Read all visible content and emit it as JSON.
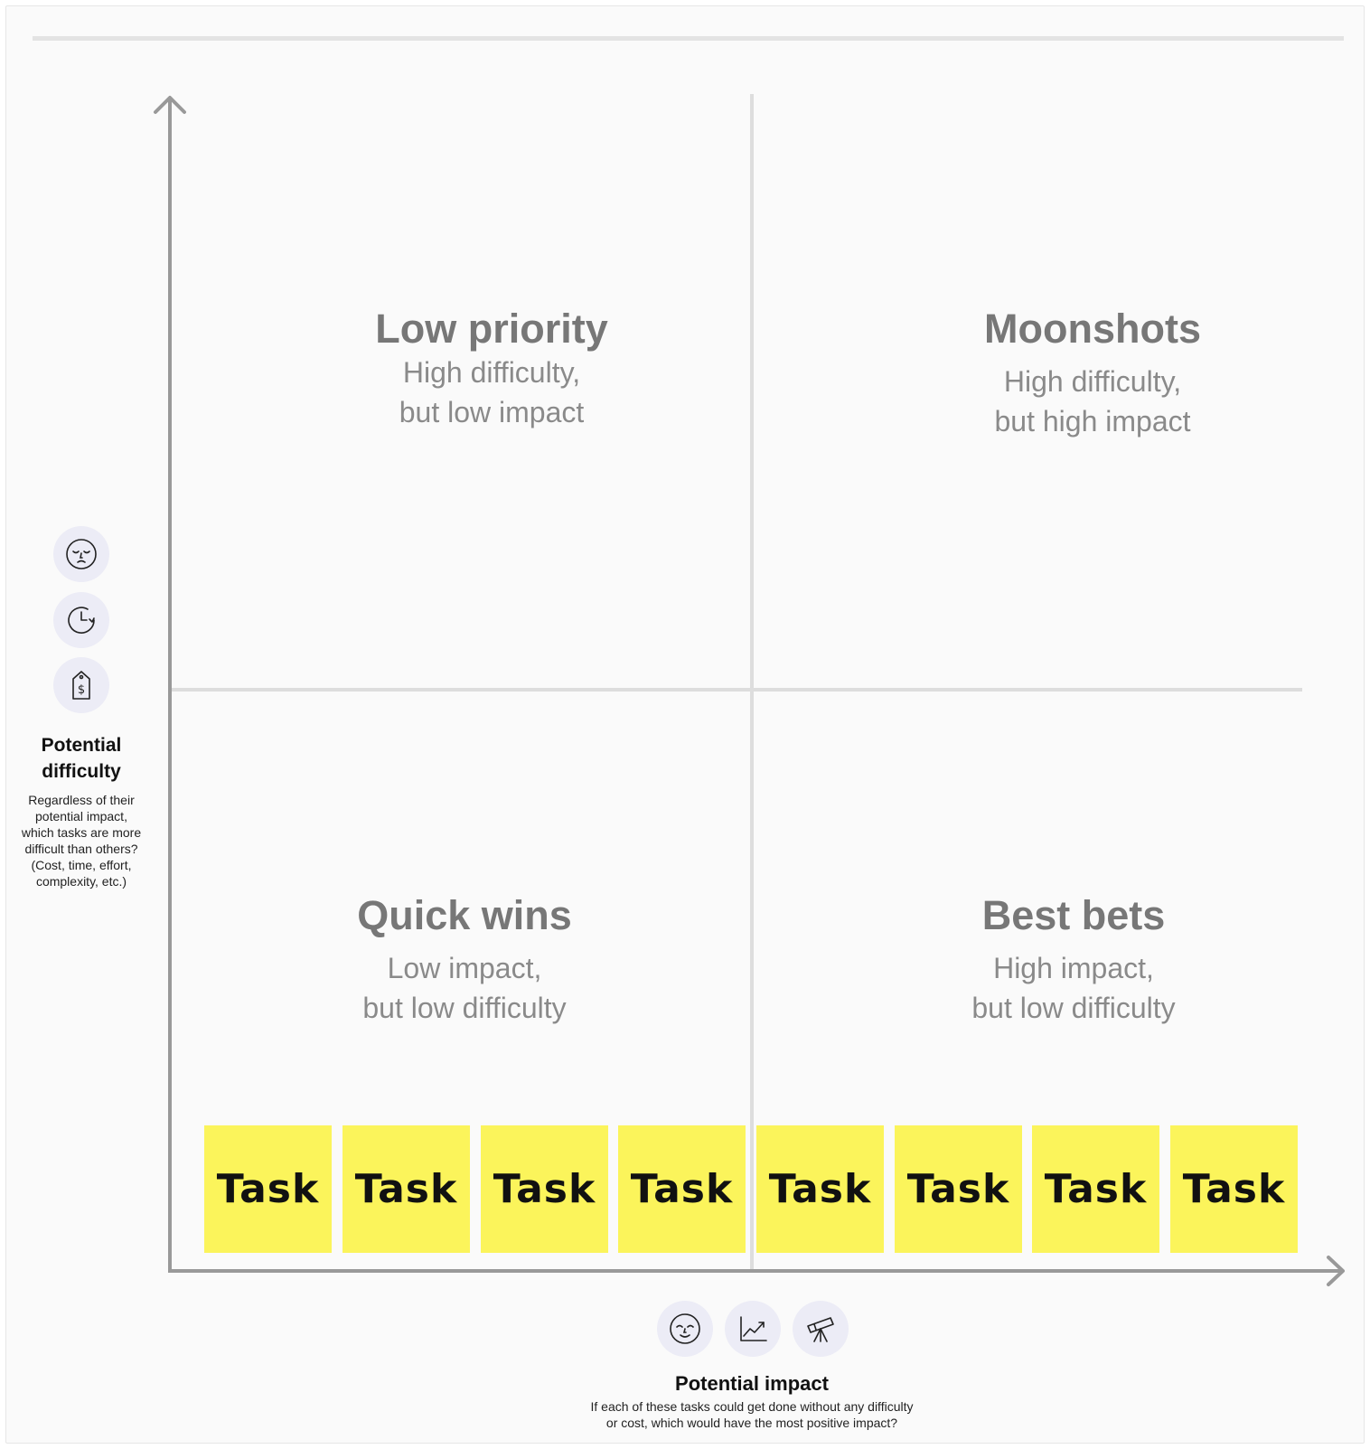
{
  "quadrants": {
    "top_left": {
      "title": "Low priority",
      "line1": "High difficulty,",
      "line2": "but low impact"
    },
    "top_right": {
      "title": "Moonshots",
      "line1": "High difficulty,",
      "line2": "but high impact"
    },
    "bottom_left": {
      "title": "Quick wins",
      "line1": "Low impact,",
      "line2": "but low difficulty"
    },
    "bottom_right": {
      "title": "Best bets",
      "line1": "High impact,",
      "line2": "but low difficulty"
    }
  },
  "stickies": [
    "Task",
    "Task",
    "Task",
    "Task",
    "Task",
    "Task",
    "Task",
    "Task"
  ],
  "y_axis": {
    "title_line1": "Potential",
    "title_line2": "difficulty",
    "desc_lines": [
      "Regardless of their",
      "potential impact,",
      "which tasks are more",
      "difficult than others?",
      "(Cost, time, effort,",
      "complexity, etc.)"
    ],
    "icons": [
      "tired-face-icon",
      "clock-icon",
      "price-tag-icon"
    ]
  },
  "x_axis": {
    "title": "Potential impact",
    "desc_line1": "If each of these tasks could get done without any difficulty",
    "desc_line2": "or cost, which would have the most positive impact?",
    "icons": [
      "happy-face-icon",
      "trend-chart-icon",
      "telescope-icon"
    ]
  },
  "colors": {
    "sticky": "#fbf45b",
    "axis": "#999999",
    "grid": "#dddddd",
    "icon_bg": "#ececf6"
  }
}
